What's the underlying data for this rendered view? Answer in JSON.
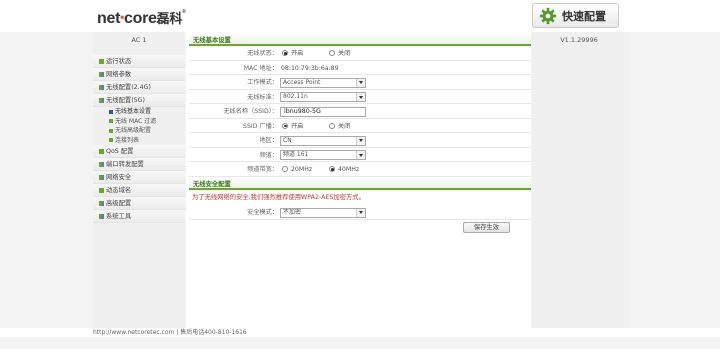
{
  "brand": {
    "name_part1": "net",
    "name_part2": "core",
    "name_cn": "磊科",
    "reg": "®"
  },
  "header": {
    "quick_setup_label": "快速配置",
    "quick_setup_icon": "gear-icon"
  },
  "device": {
    "model": "AC 1",
    "version": "V1.1.29996"
  },
  "sidebar": {
    "items": [
      {
        "label": "运行状态"
      },
      {
        "label": "网络参数"
      },
      {
        "label": "无线配置(2.4G)"
      },
      {
        "label": "无线配置(5G)"
      },
      {
        "label": "QoS 配置"
      },
      {
        "label": "端口转发配置"
      },
      {
        "label": "网络安全"
      },
      {
        "label": "动态域名"
      },
      {
        "label": "高级配置"
      },
      {
        "label": "系统工具"
      }
    ],
    "subitems_5g": [
      {
        "label": "无线基本设置"
      },
      {
        "label": "无线 MAC 过滤"
      },
      {
        "label": "无线高级配置"
      },
      {
        "label": "连接列表"
      }
    ]
  },
  "basic": {
    "title": "无线基本设置",
    "wireless_status": {
      "label": "无线状态：",
      "on": "开启",
      "off": "关闭"
    },
    "mac": {
      "label": "MAC 地址：",
      "value": "08:10:79:3b:6a:89"
    },
    "mode": {
      "label": "工作模式：",
      "value": "Access Point"
    },
    "standard": {
      "label": "无线标准：",
      "value": "802.11n"
    },
    "ssid": {
      "label": "无线名称（SSID）：",
      "value": "ibnu980-5G"
    },
    "ssid_broadcast": {
      "label": "SSID 广播：",
      "on": "开启",
      "off": "关闭"
    },
    "region": {
      "label": "地区：",
      "value": "CN"
    },
    "channel": {
      "label": "频道：",
      "value": "频道 161"
    },
    "bandwidth": {
      "label": "频道带宽：",
      "opt1": "20MHz",
      "opt2": "40MHz"
    }
  },
  "security": {
    "title": "无线安全配置",
    "warning": "为了无线网络的安全,我们强烈推荐使用WPA2-AES加密方式。",
    "mode": {
      "label": "安全模式：",
      "value": "不加密"
    },
    "save_label": "保存生效"
  },
  "footer": {
    "text": "http://www.netcoretec.com | 售后电话400-810-1616"
  },
  "colors": {
    "accent_green": "#6aa82a",
    "warning_red": "#c0392b"
  }
}
